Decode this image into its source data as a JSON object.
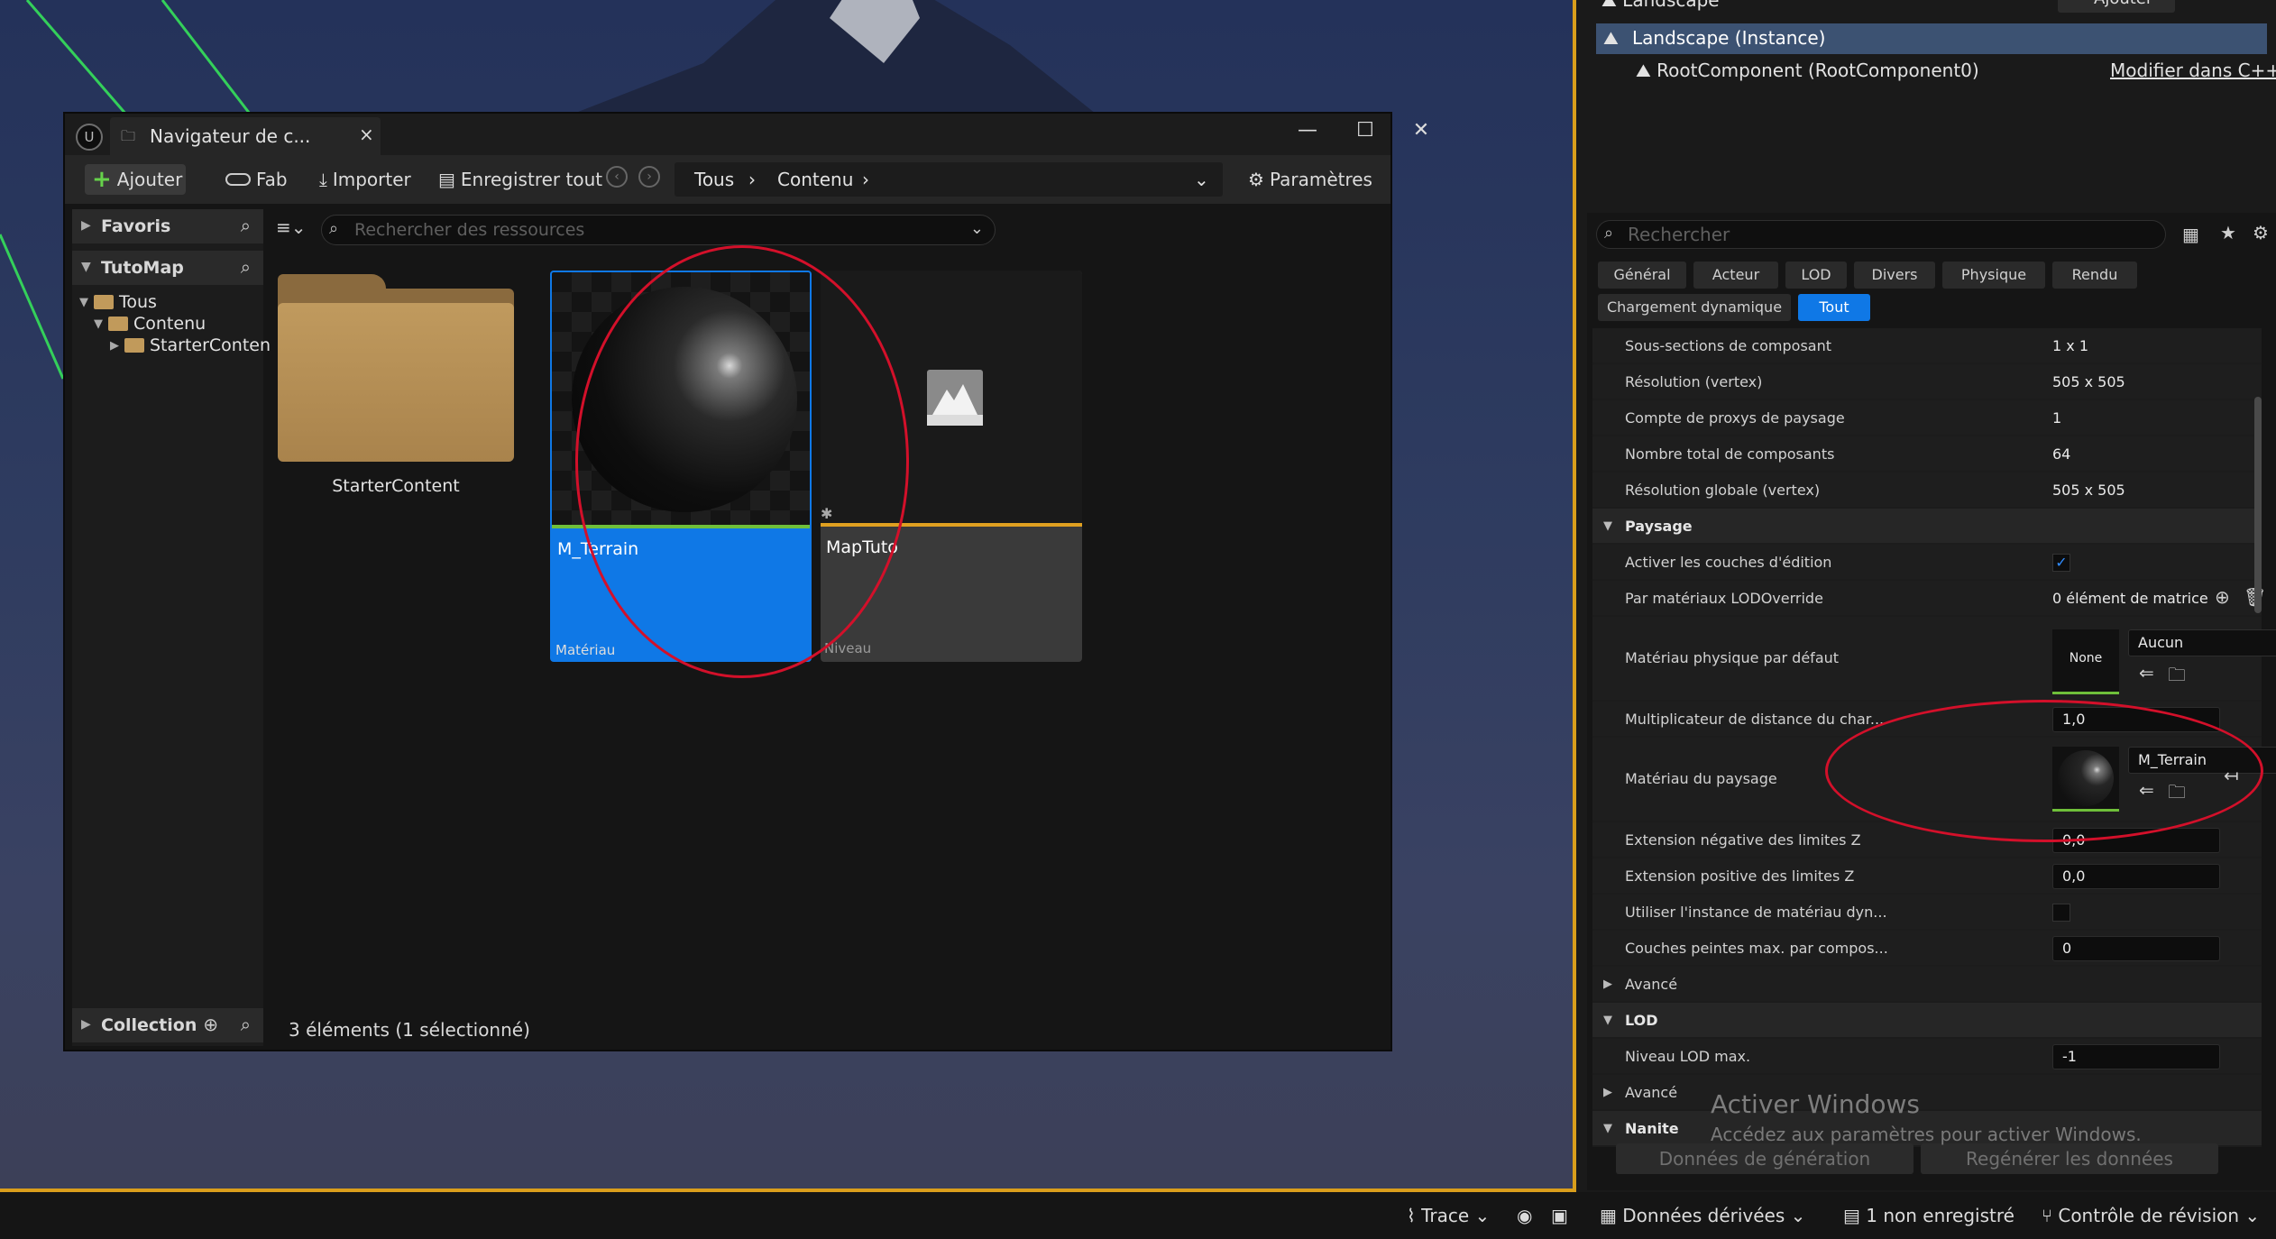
{
  "content_browser": {
    "tab_title": "Navigateur de c...",
    "toolbar": {
      "add": "Ajouter",
      "fab": "Fab",
      "import": "Importer",
      "save_all": "Enregistrer tout",
      "breadcrumb": [
        "Tous",
        "Contenu"
      ],
      "settings": "Paramètres"
    },
    "sidebar": {
      "favorites": "Favoris",
      "project": "TutoMap",
      "tree": [
        "Tous",
        "Contenu",
        "StarterConten"
      ],
      "collections": "Collection"
    },
    "search_placeholder": "Rechercher des ressources",
    "assets": [
      {
        "name": "StarterContent",
        "type": ""
      },
      {
        "name": "M_Terrain",
        "type": "Matériau"
      },
      {
        "name": "MapTuto",
        "type": "Niveau"
      }
    ],
    "status": "3 éléments (1 sélectionné)"
  },
  "details": {
    "title": "Landscape",
    "add_button": "Ajouter",
    "selected": "Landscape (Instance)",
    "root_component": "RootComponent (RootComponent0)",
    "edit_cpp": "Modifier dans C++",
    "search_placeholder": "Rechercher",
    "filters": [
      "Général",
      "Acteur",
      "LOD",
      "Divers",
      "Physique",
      "Rendu",
      "Chargement dynamique",
      "Tout"
    ],
    "rows": {
      "r1": {
        "k": "Sous-sections de composant",
        "v": "1 x 1"
      },
      "r2": {
        "k": "Résolution (vertex)",
        "v": "505 x 505"
      },
      "r3": {
        "k": "Compte de proxys de paysage",
        "v": "1"
      },
      "r4": {
        "k": "Nombre total de composants",
        "v": "64"
      },
      "r5": {
        "k": "Résolution globale (vertex)",
        "v": "505 x 505"
      },
      "paysage": "Paysage",
      "r6": {
        "k": "Activer les couches d'édition"
      },
      "r7": {
        "k": "Par matériaux LODOverride",
        "v": "0 élément de matrice"
      },
      "r8": {
        "k": "Matériau physique par défaut",
        "thumb": "None",
        "dropdown": "Aucun"
      },
      "r9": {
        "k": "Multiplicateur de distance du char...",
        "v": "1,0"
      },
      "r10": {
        "k": "Matériau du paysage",
        "dropdown": "M_Terrain"
      },
      "r11": {
        "k": "Extension négative des limites Z",
        "v": "0,0"
      },
      "r12": {
        "k": "Extension positive des limites Z",
        "v": "0,0"
      },
      "r13": {
        "k": "Utiliser l'instance de matériau dyn..."
      },
      "r14": {
        "k": "Couches peintes max. par compos...",
        "v": "0"
      },
      "avance1": "Avancé",
      "lod": "LOD",
      "r15": {
        "k": "Niveau LOD max.",
        "v": "-1"
      },
      "avance2": "Avancé",
      "nanite": "Nanite"
    },
    "buttons": [
      "Données de génération",
      "Regénérer les données"
    ]
  },
  "watermark": {
    "line1": "Activer Windows",
    "line2": "Accédez aux paramètres pour activer Windows."
  },
  "statusbar": {
    "trace": "Trace",
    "derived": "Données dérivées",
    "unsaved": "1 non enregistré",
    "revision": "Contrôle de révision"
  },
  "colors": {
    "accent": "#0f78e6",
    "viewport_border": "#d99e1c",
    "annotation": "#d3102a",
    "material_bar": "#6fbf3a",
    "level_bar": "#e0a020"
  }
}
